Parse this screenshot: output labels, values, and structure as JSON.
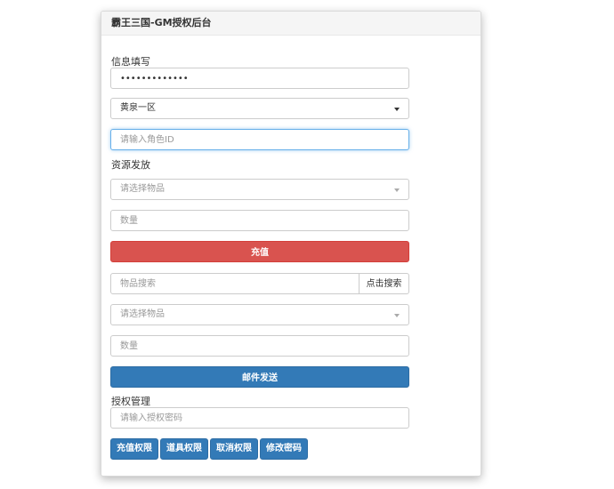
{
  "panel": {
    "title": "霸王三国-GM授权后台"
  },
  "info": {
    "label": "信息填写",
    "password_value": "•••••••••••••",
    "server_select": "黄泉一区",
    "role_id_placeholder": "请输入角色ID"
  },
  "resource": {
    "label": "资源发放",
    "item_select_placeholder": "请选择物品",
    "quantity_placeholder": "数量",
    "recharge_button": "充值"
  },
  "mail": {
    "search_placeholder": "物品搜索",
    "search_button": "点击搜索",
    "item_select_placeholder": "请选择物品",
    "quantity_placeholder": "数量",
    "send_button": "邮件发送"
  },
  "auth": {
    "label": "授权管理",
    "password_placeholder": "请输入授权密码",
    "buttons": [
      "充值权限",
      "道具权限",
      "取消权限",
      "修改密码"
    ]
  },
  "colors": {
    "danger": "#d9534f",
    "primary": "#337ab7",
    "focus": "#66afe9"
  }
}
